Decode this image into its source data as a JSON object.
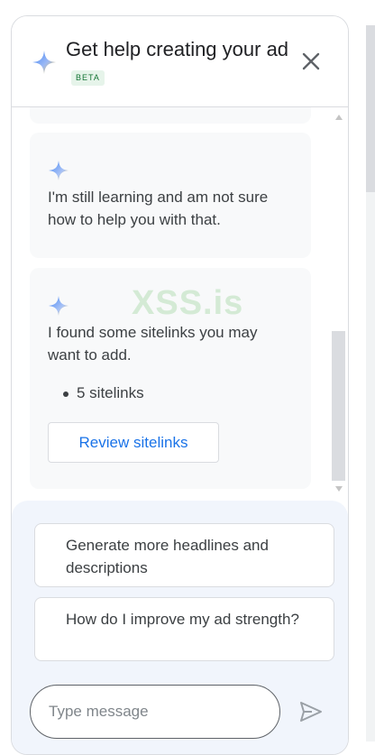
{
  "header": {
    "title": "Get help creating your ad",
    "badge": "BETA"
  },
  "messages": [
    {
      "text": "I'm still learning and am not sure how to help you with that."
    },
    {
      "text": "I found some sitelinks you may want to add.",
      "bullets": [
        "5 sitelinks"
      ],
      "action_label": "Review sitelinks"
    }
  ],
  "watermark": "XSS.is",
  "suggestions": [
    "Generate more headlines and descriptions",
    "How do I improve my ad strength?"
  ],
  "composer": {
    "placeholder": "Type message"
  },
  "icons": {
    "assistant": "sparkle-icon",
    "close": "close-icon",
    "send": "send-icon"
  },
  "colors": {
    "accent_blue": "#1a73e8",
    "beta_green": "#137333",
    "card_bg": "#f8f9fa",
    "composer_bg": "#f1f5fc"
  }
}
